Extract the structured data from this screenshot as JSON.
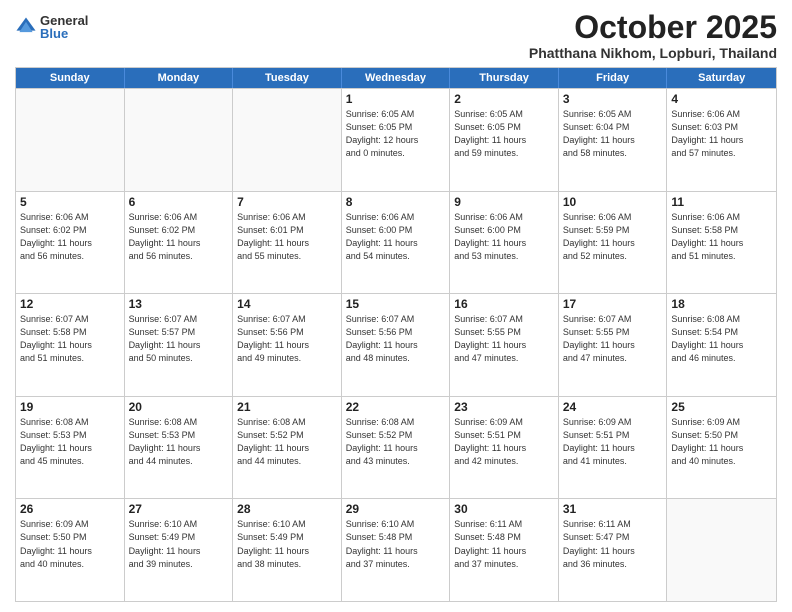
{
  "logo": {
    "general": "General",
    "blue": "Blue"
  },
  "title": "October 2025",
  "location": "Phatthana Nikhom, Lopburi, Thailand",
  "headers": [
    "Sunday",
    "Monday",
    "Tuesday",
    "Wednesday",
    "Thursday",
    "Friday",
    "Saturday"
  ],
  "rows": [
    [
      {
        "day": "",
        "info": ""
      },
      {
        "day": "",
        "info": ""
      },
      {
        "day": "",
        "info": ""
      },
      {
        "day": "1",
        "info": "Sunrise: 6:05 AM\nSunset: 6:05 PM\nDaylight: 12 hours\nand 0 minutes."
      },
      {
        "day": "2",
        "info": "Sunrise: 6:05 AM\nSunset: 6:05 PM\nDaylight: 11 hours\nand 59 minutes."
      },
      {
        "day": "3",
        "info": "Sunrise: 6:05 AM\nSunset: 6:04 PM\nDaylight: 11 hours\nand 58 minutes."
      },
      {
        "day": "4",
        "info": "Sunrise: 6:06 AM\nSunset: 6:03 PM\nDaylight: 11 hours\nand 57 minutes."
      }
    ],
    [
      {
        "day": "5",
        "info": "Sunrise: 6:06 AM\nSunset: 6:02 PM\nDaylight: 11 hours\nand 56 minutes."
      },
      {
        "day": "6",
        "info": "Sunrise: 6:06 AM\nSunset: 6:02 PM\nDaylight: 11 hours\nand 56 minutes."
      },
      {
        "day": "7",
        "info": "Sunrise: 6:06 AM\nSunset: 6:01 PM\nDaylight: 11 hours\nand 55 minutes."
      },
      {
        "day": "8",
        "info": "Sunrise: 6:06 AM\nSunset: 6:00 PM\nDaylight: 11 hours\nand 54 minutes."
      },
      {
        "day": "9",
        "info": "Sunrise: 6:06 AM\nSunset: 6:00 PM\nDaylight: 11 hours\nand 53 minutes."
      },
      {
        "day": "10",
        "info": "Sunrise: 6:06 AM\nSunset: 5:59 PM\nDaylight: 11 hours\nand 52 minutes."
      },
      {
        "day": "11",
        "info": "Sunrise: 6:06 AM\nSunset: 5:58 PM\nDaylight: 11 hours\nand 51 minutes."
      }
    ],
    [
      {
        "day": "12",
        "info": "Sunrise: 6:07 AM\nSunset: 5:58 PM\nDaylight: 11 hours\nand 51 minutes."
      },
      {
        "day": "13",
        "info": "Sunrise: 6:07 AM\nSunset: 5:57 PM\nDaylight: 11 hours\nand 50 minutes."
      },
      {
        "day": "14",
        "info": "Sunrise: 6:07 AM\nSunset: 5:56 PM\nDaylight: 11 hours\nand 49 minutes."
      },
      {
        "day": "15",
        "info": "Sunrise: 6:07 AM\nSunset: 5:56 PM\nDaylight: 11 hours\nand 48 minutes."
      },
      {
        "day": "16",
        "info": "Sunrise: 6:07 AM\nSunset: 5:55 PM\nDaylight: 11 hours\nand 47 minutes."
      },
      {
        "day": "17",
        "info": "Sunrise: 6:07 AM\nSunset: 5:55 PM\nDaylight: 11 hours\nand 47 minutes."
      },
      {
        "day": "18",
        "info": "Sunrise: 6:08 AM\nSunset: 5:54 PM\nDaylight: 11 hours\nand 46 minutes."
      }
    ],
    [
      {
        "day": "19",
        "info": "Sunrise: 6:08 AM\nSunset: 5:53 PM\nDaylight: 11 hours\nand 45 minutes."
      },
      {
        "day": "20",
        "info": "Sunrise: 6:08 AM\nSunset: 5:53 PM\nDaylight: 11 hours\nand 44 minutes."
      },
      {
        "day": "21",
        "info": "Sunrise: 6:08 AM\nSunset: 5:52 PM\nDaylight: 11 hours\nand 44 minutes."
      },
      {
        "day": "22",
        "info": "Sunrise: 6:08 AM\nSunset: 5:52 PM\nDaylight: 11 hours\nand 43 minutes."
      },
      {
        "day": "23",
        "info": "Sunrise: 6:09 AM\nSunset: 5:51 PM\nDaylight: 11 hours\nand 42 minutes."
      },
      {
        "day": "24",
        "info": "Sunrise: 6:09 AM\nSunset: 5:51 PM\nDaylight: 11 hours\nand 41 minutes."
      },
      {
        "day": "25",
        "info": "Sunrise: 6:09 AM\nSunset: 5:50 PM\nDaylight: 11 hours\nand 40 minutes."
      }
    ],
    [
      {
        "day": "26",
        "info": "Sunrise: 6:09 AM\nSunset: 5:50 PM\nDaylight: 11 hours\nand 40 minutes."
      },
      {
        "day": "27",
        "info": "Sunrise: 6:10 AM\nSunset: 5:49 PM\nDaylight: 11 hours\nand 39 minutes."
      },
      {
        "day": "28",
        "info": "Sunrise: 6:10 AM\nSunset: 5:49 PM\nDaylight: 11 hours\nand 38 minutes."
      },
      {
        "day": "29",
        "info": "Sunrise: 6:10 AM\nSunset: 5:48 PM\nDaylight: 11 hours\nand 37 minutes."
      },
      {
        "day": "30",
        "info": "Sunrise: 6:11 AM\nSunset: 5:48 PM\nDaylight: 11 hours\nand 37 minutes."
      },
      {
        "day": "31",
        "info": "Sunrise: 6:11 AM\nSunset: 5:47 PM\nDaylight: 11 hours\nand 36 minutes."
      },
      {
        "day": "",
        "info": ""
      }
    ]
  ]
}
